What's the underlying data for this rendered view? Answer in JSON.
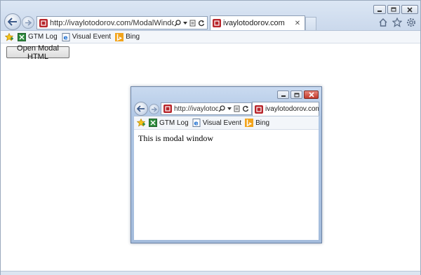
{
  "main_window": {
    "address_url": "http://ivaylotodorov.com/ModalWindow/ModalBu",
    "tab_title": "ivaylotodorov.com",
    "favorites": [
      {
        "label": "GTM Log",
        "icon": "gtm-log-icon"
      },
      {
        "label": "Visual Event",
        "icon": "visual-event-icon"
      },
      {
        "label": "Bing",
        "icon": "bing-icon"
      }
    ],
    "open_button_label": "Open Modal HTML"
  },
  "modal_window": {
    "address_url": "http://ivaylotodo...",
    "tab_title": "ivaylotodorov.com",
    "favorites": [
      {
        "label": "GTM Log",
        "icon": "gtm-log-icon"
      },
      {
        "label": "Visual Event",
        "icon": "visual-event-icon"
      },
      {
        "label": "Bing",
        "icon": "bing-icon"
      }
    ],
    "body_text": "This is modal window"
  },
  "colors": {
    "frame_blue": "#c5d4e8",
    "site_icon_red": "#b8252b",
    "close_button_red": "#c2392b",
    "gtm_green": "#2e8b3e",
    "bing_orange": "#f2a41c"
  }
}
